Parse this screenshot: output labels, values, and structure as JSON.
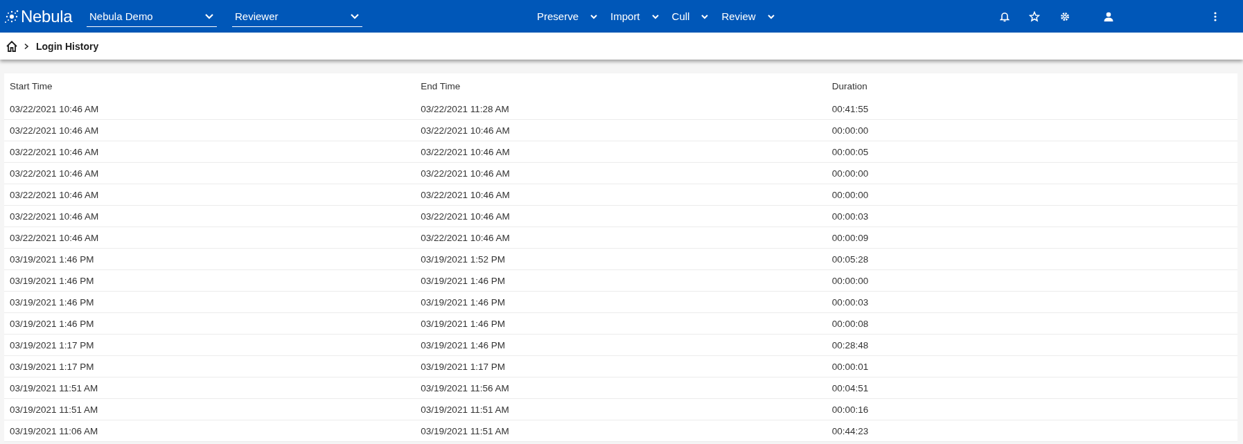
{
  "header": {
    "logo": "Nebula",
    "selects": [
      {
        "value": "Nebula Demo"
      },
      {
        "value": "Reviewer"
      }
    ],
    "menu": [
      {
        "label": "Preserve"
      },
      {
        "label": "Import"
      },
      {
        "label": "Cull"
      },
      {
        "label": "Review"
      }
    ]
  },
  "breadcrumb": {
    "current": "Login History"
  },
  "table": {
    "columns": [
      "Start Time",
      "End Time",
      "Duration"
    ],
    "rows": [
      [
        "03/22/2021 10:46 AM",
        "03/22/2021 11:28 AM",
        "00:41:55"
      ],
      [
        "03/22/2021 10:46 AM",
        "03/22/2021 10:46 AM",
        "00:00:00"
      ],
      [
        "03/22/2021 10:46 AM",
        "03/22/2021 10:46 AM",
        "00:00:05"
      ],
      [
        "03/22/2021 10:46 AM",
        "03/22/2021 10:46 AM",
        "00:00:00"
      ],
      [
        "03/22/2021 10:46 AM",
        "03/22/2021 10:46 AM",
        "00:00:00"
      ],
      [
        "03/22/2021 10:46 AM",
        "03/22/2021 10:46 AM",
        "00:00:03"
      ],
      [
        "03/22/2021 10:46 AM",
        "03/22/2021 10:46 AM",
        "00:00:09"
      ],
      [
        "03/19/2021 1:46 PM",
        "03/19/2021 1:52 PM",
        "00:05:28"
      ],
      [
        "03/19/2021 1:46 PM",
        "03/19/2021 1:46 PM",
        "00:00:00"
      ],
      [
        "03/19/2021 1:46 PM",
        "03/19/2021 1:46 PM",
        "00:00:03"
      ],
      [
        "03/19/2021 1:46 PM",
        "03/19/2021 1:46 PM",
        "00:00:08"
      ],
      [
        "03/19/2021 1:17 PM",
        "03/19/2021 1:46 PM",
        "00:28:48"
      ],
      [
        "03/19/2021 1:17 PM",
        "03/19/2021 1:17 PM",
        "00:00:01"
      ],
      [
        "03/19/2021 11:51 AM",
        "03/19/2021 11:56 AM",
        "00:04:51"
      ],
      [
        "03/19/2021 11:51 AM",
        "03/19/2021 11:51 AM",
        "00:00:16"
      ],
      [
        "03/19/2021 11:06 AM",
        "03/19/2021 11:51 AM",
        "00:44:23"
      ]
    ]
  }
}
